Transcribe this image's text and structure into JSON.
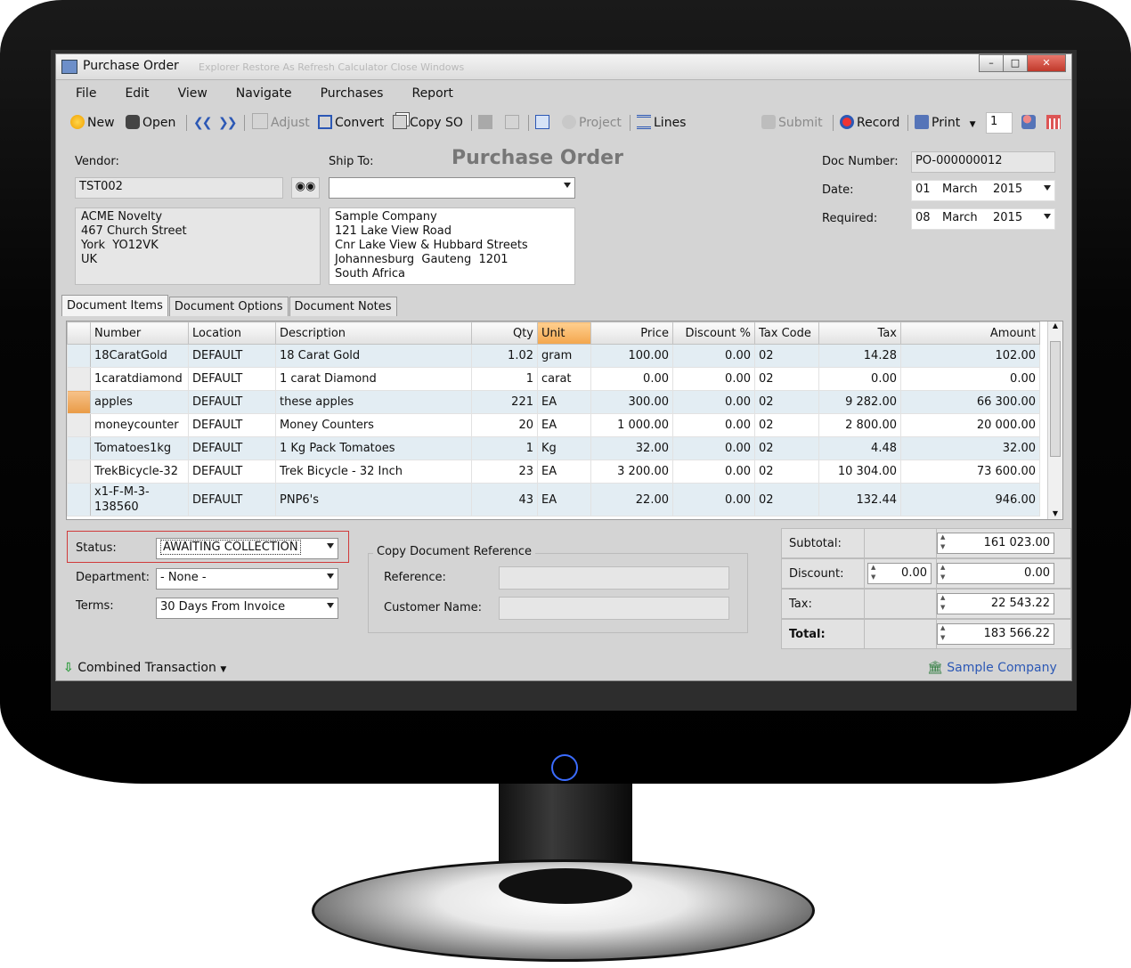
{
  "window": {
    "title": "Purchase Order",
    "ghost_toolbar": "Explorer   Restore As   Refresh   Calculator   Close Windows"
  },
  "menu": [
    "File",
    "Edit",
    "View",
    "Navigate",
    "Purchases",
    "Report"
  ],
  "toolbar": {
    "new": "New",
    "open": "Open",
    "adjust": "Adjust",
    "convert": "Convert",
    "copy_so": "Copy SO",
    "project": "Project",
    "lines": "Lines",
    "submit": "Submit",
    "record": "Record",
    "print": "Print",
    "copies": "1"
  },
  "header": {
    "vendor_label": "Vendor:",
    "vendor_code": "TST002",
    "vendor_address": "ACME Novelty\n467 Church Street\nYork  YO12VK\nUK",
    "ship_to_label": "Ship To:",
    "ship_to_value": "",
    "ship_address": "Sample Company\n121 Lake View Road\nCnr Lake View & Hubbard Streets\nJohannesburg  Gauteng  1201\nSouth Africa",
    "doc_title": "Purchase Order",
    "doc_number_label": "Doc Number:",
    "doc_number": "PO-000000012",
    "date_label": "Date:",
    "date_day": "01",
    "date_month": "March",
    "date_year": "2015",
    "required_label": "Required:",
    "req_day": "08",
    "req_month": "March",
    "req_year": "2015"
  },
  "tabs": [
    "Document Items",
    "Document Options",
    "Document Notes"
  ],
  "grid": {
    "columns": [
      "Number",
      "Location",
      "Description",
      "Qty",
      "Unit",
      "Price",
      "Discount %",
      "Tax Code",
      "Tax",
      "Amount"
    ],
    "rows": [
      [
        "18CaratGold",
        "DEFAULT",
        "18 Carat Gold",
        "1.02",
        "gram",
        "100.00",
        "0.00",
        "02",
        "14.28",
        "102.00"
      ],
      [
        "1caratdiamond",
        "DEFAULT",
        "1 carat Diamond",
        "1",
        "carat",
        "0.00",
        "0.00",
        "02",
        "0.00",
        "0.00"
      ],
      [
        "apples",
        "DEFAULT",
        "these apples",
        "221",
        "EA",
        "300.00",
        "0.00",
        "02",
        "9 282.00",
        "66 300.00"
      ],
      [
        "moneycounter",
        "DEFAULT",
        "Money Counters",
        "20",
        "EA",
        "1 000.00",
        "0.00",
        "02",
        "2 800.00",
        "20 000.00"
      ],
      [
        "Tomatoes1kg",
        "DEFAULT",
        "1 Kg Pack Tomatoes",
        "1",
        "Kg",
        "32.00",
        "0.00",
        "02",
        "4.48",
        "32.00"
      ],
      [
        "TrekBicycle-32",
        "DEFAULT",
        "Trek Bicycle - 32 Inch",
        "23",
        "EA",
        "3 200.00",
        "0.00",
        "02",
        "10 304.00",
        "73 600.00"
      ],
      [
        "x1-F-M-3-\n138560",
        "DEFAULT",
        "PNP6's",
        "43",
        "EA",
        "22.00",
        "0.00",
        "02",
        "132.44",
        "946.00"
      ]
    ]
  },
  "footer": {
    "status_label": "Status:",
    "status_value": "AWAITING COLLECTION",
    "department_label": "Department:",
    "department_value": "- None -",
    "terms_label": "Terms:",
    "terms_value": "30 Days From Invoice",
    "copy_ref_title": "Copy Document Reference",
    "reference_label": "Reference:",
    "reference_value": "",
    "customer_name_label": "Customer Name:",
    "customer_name_value": ""
  },
  "totals": {
    "subtotal_label": "Subtotal:",
    "subtotal": "161 023.00",
    "discount_label": "Discount:",
    "discount_pct": "0.00",
    "discount": "0.00",
    "tax_label": "Tax:",
    "tax": "22 543.22",
    "total_label": "Total:",
    "total": "183 566.22"
  },
  "statusbar": {
    "combined": "Combined Transaction",
    "company": "Sample Company"
  }
}
